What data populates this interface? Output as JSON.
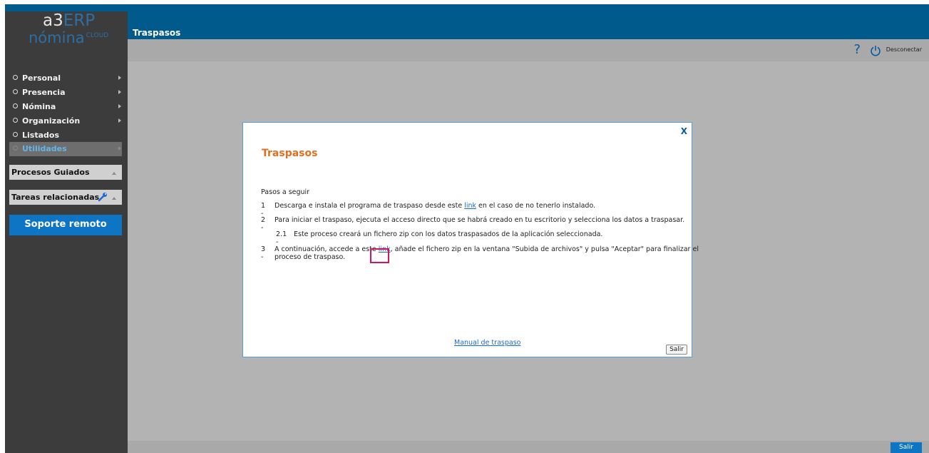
{
  "header": {
    "page_title": "Traspasos",
    "help_label": "?",
    "logout_label": "Desconectar"
  },
  "logo": {
    "a3": "a3",
    "erp": "ERP",
    "nomina": "nómina",
    "cloud": "CLOUD"
  },
  "sidebar": {
    "items": [
      {
        "label": "Personal"
      },
      {
        "label": "Presencia"
      },
      {
        "label": "Nómina"
      },
      {
        "label": "Organización"
      },
      {
        "label": "Listados"
      },
      {
        "label": "Utilidades"
      }
    ],
    "panels": [
      {
        "label": "Procesos Guiados"
      },
      {
        "label": "Tareas relacionadas"
      }
    ],
    "remote_support": "Soporte remoto"
  },
  "footer": {
    "exit_label": "Salir"
  },
  "modal": {
    "close_label": "X",
    "title": "Traspasos",
    "intro": "Pasos a seguir",
    "steps": [
      {
        "num": "1 -",
        "before": "Descarga e instala el programa de traspaso desde este ",
        "link": "link",
        "after": " en el caso de no tenerlo instalado."
      },
      {
        "num": "2 -",
        "text": "Para iniciar el traspaso, ejecuta el acceso directo que se habrá creado en tu escritorio y selecciona los datos a traspasar."
      },
      {
        "num": "2.1 -",
        "text": "Este proceso creará un fichero zip con los datos traspasados de la aplicación seleccionada."
      },
      {
        "num": "3 -",
        "before": "A continuación, accede a este ",
        "link": "link",
        "after": ", añade el fichero zip en la ventana \"Subida de archivos\" y pulsa \"Aceptar\" para finalizar el",
        "line2": "proceso de traspaso."
      }
    ],
    "manual_link": "Manual de traspaso",
    "exit_label": "Salir"
  },
  "colors": {
    "brand_blue": "#005a8c",
    "accent_orange": "#e07020",
    "link_blue": "#1a6ad6",
    "highlight": "#d4145a"
  }
}
